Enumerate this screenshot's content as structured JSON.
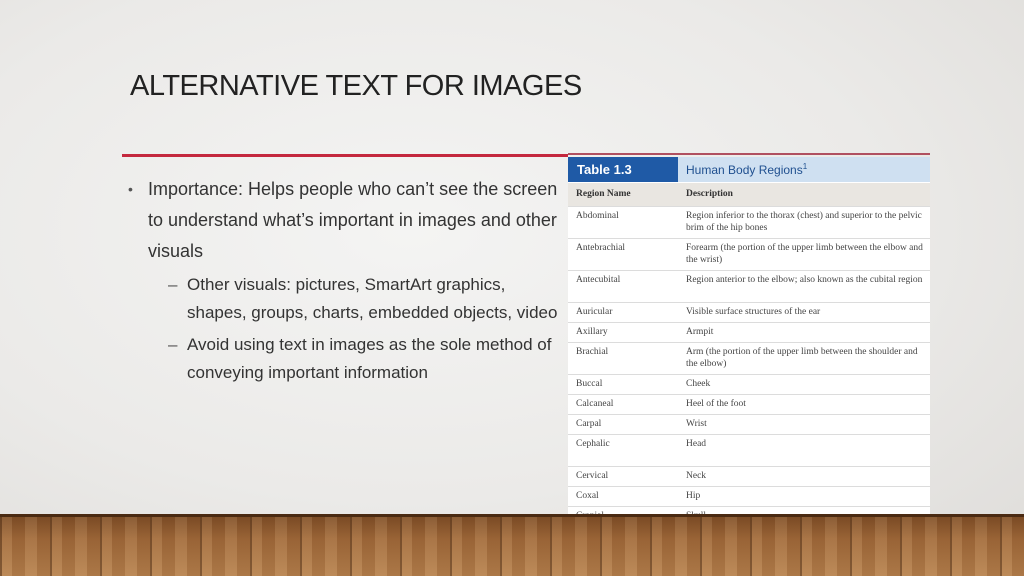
{
  "slide": {
    "title": "ALTERNATIVE TEXT FOR IMAGES",
    "bullets": {
      "main": "Importance: Helps people who can’t see the screen to understand what’s important in images and other visuals",
      "sub": [
        "Other visuals: pictures, SmartArt graphics, shapes, groups, charts, embedded objects, video",
        "Avoid using text in images as the sole method of conveying important information"
      ]
    }
  },
  "table": {
    "number": "Table 1.3",
    "name": "Human Body Regions",
    "footnote": "1",
    "col_headers": [
      "Region Name",
      "Description"
    ],
    "rows": [
      [
        "Abdominal",
        "Region inferior to the thorax (chest) and superior to the pelvic brim of the hip bones"
      ],
      [
        "Antebrachial",
        "Forearm (the portion of the upper limb between the elbow and the wrist)"
      ],
      [
        "Antecubital",
        "Region anterior to the elbow; also known as the cubital region"
      ],
      [
        "Auricular",
        "Visible surface structures of the ear"
      ],
      [
        "Axillary",
        "Armpit"
      ],
      [
        "Brachial",
        "Arm (the portion of the upper limb between the shoulder and the elbow)"
      ],
      [
        "Buccal",
        "Cheek"
      ],
      [
        "Calcaneal",
        "Heel of the foot"
      ],
      [
        "Carpal",
        "Wrist"
      ],
      [
        "Cephalic",
        "Head"
      ],
      [
        "Cervical",
        "Neck"
      ],
      [
        "Coxal",
        "Hip"
      ],
      [
        "Cranial",
        "Skull"
      ]
    ]
  },
  "colors": {
    "accent_rule": "#c4283e",
    "table_number_bg": "#1f5aa6",
    "table_name_bg": "#cfe0f1"
  }
}
